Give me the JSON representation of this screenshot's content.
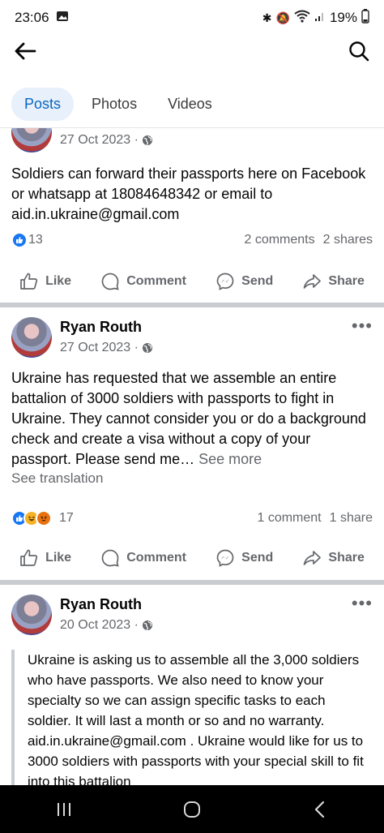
{
  "status_bar": {
    "time": "23:06",
    "battery": "19%"
  },
  "tabs": [
    {
      "label": "Posts",
      "active": true
    },
    {
      "label": "Photos",
      "active": false
    },
    {
      "label": "Videos",
      "active": false
    }
  ],
  "posts": [
    {
      "date": "27 Oct 2023 ·",
      "text": "Soldiers can forward their passports here on Facebook or whatsapp at 18084648342 or email to aid.in.ukraine@gmail.com",
      "reaction_count": "13",
      "comments": "2 comments",
      "shares": "2 shares"
    },
    {
      "author": "Ryan Routh",
      "date": "27 Oct 2023 ·",
      "text": "Ukraine has requested that we assemble an entire battalion of 3000 soldiers with passports to fight in Ukraine. They cannot consider you or do a background check and create a visa without a copy of your passport. Please send me…",
      "see_more": "See more",
      "see_translation": "See translation",
      "reaction_count": "17",
      "comments": "1 comment",
      "shares": "1 share"
    },
    {
      "author": "Ryan Routh",
      "date": "20 Oct 2023 ·",
      "text": "Ukraine is asking us to assemble all the 3,000 soldiers who have passports. We also need to know your specialty so we can assign specific tasks to each soldier. It will last a month or so and no warranty. aid.in.ukraine@gmail.com . Ukraine would like for us to 3000 soldiers with passports with your special skill to fit into this battalion"
    }
  ],
  "actions": {
    "like": "Like",
    "comment": "Comment",
    "send": "Send",
    "share": "Share"
  },
  "colors": {
    "accent": "#0a66c2",
    "like_blue": "#1877f2",
    "meta_gray": "#65676b"
  }
}
